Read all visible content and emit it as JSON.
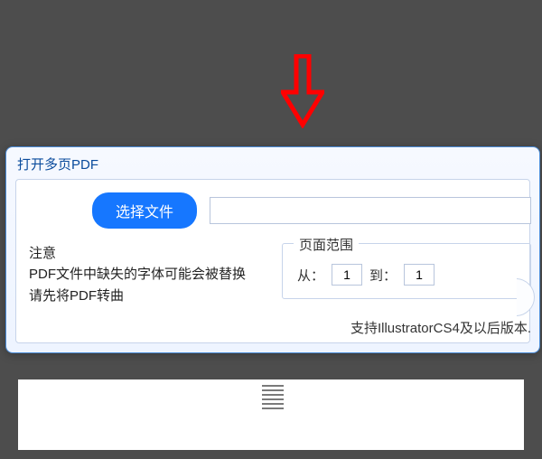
{
  "dialog": {
    "title": "打开多页PDF",
    "select_file_label": "选择文件",
    "file_path_value": "",
    "notice_heading": "注意",
    "notice_line1": "PDF文件中缺失的字体可能会被替换",
    "notice_line2": "请先将PDF转曲",
    "page_range_label": "页面范围",
    "from_label": "从：",
    "to_label": "到：",
    "from_value": "1",
    "to_value": "1",
    "support_text": "支持IllustratorCS4及以后版本."
  },
  "annotation": {
    "arrow_color": "#ff0000"
  }
}
